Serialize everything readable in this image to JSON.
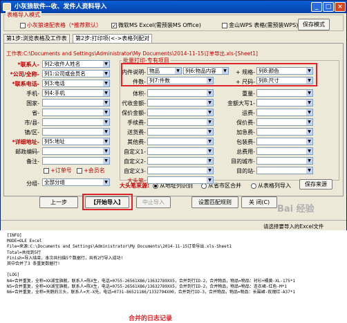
{
  "window": {
    "title": "小灰狼软件--收、发件人资料导入"
  },
  "top": {
    "group_label": "表格导入模式",
    "opt1": "小灰狼速配表格（*推荐默认）",
    "opt2": "微软MS Excel(需预装MS Office)",
    "opt3": "金山WPS 表格(需预装WPS)",
    "save_mode": "保存模式"
  },
  "tabs": [
    {
      "label": "第1步:浏览表格及工作表"
    },
    {
      "label": "第2步:打印项(<->表格列配对"
    }
  ],
  "worksheet": "工作表:C:\\Documents and Settings\\Administrator\\My Documents\\2014-11-15订单导出.xls-[Sheet1]",
  "left_fields": [
    {
      "label": "*联系人-",
      "value": "列2:收件人姓名"
    },
    {
      "label": "*公司/全称-",
      "value": "列1:公司或会员名"
    },
    {
      "label": "*联系电话-",
      "value": "列3:电话"
    },
    {
      "label": "手机-",
      "value": "列4:手机"
    },
    {
      "label": "国家-",
      "value": ""
    },
    {
      "label": "省-",
      "value": ""
    },
    {
      "label": "市/县-",
      "value": ""
    },
    {
      "label": "镇/区-",
      "value": ""
    },
    {
      "label": "*详细地址-",
      "value": "列5:地址"
    },
    {
      "label": "邮政编码-",
      "value": ""
    },
    {
      "label": "备注-",
      "value": ""
    }
  ],
  "remark_checks": {
    "a": "+订单号",
    "b": "+会员名"
  },
  "group": {
    "label": "分组-",
    "value": "全部分组"
  },
  "batch": {
    "label": "批量打印-专有项目",
    "name_label": "内件说明-",
    "name_a": "物品",
    "name_b": "列6:物品内容",
    "spec_label": "+ 规格-",
    "spec_value": "列8:颜色",
    "qty_label": "件数-",
    "qty_value": "列7:件数",
    "size_label": "+ 尺码-",
    "size_value": "列8:尺寸"
  },
  "mid_fields": [
    "体积-",
    "代收金额-",
    "保价金额-",
    "手续费-",
    "送货费-",
    "其他费-",
    "自定义1-",
    "自定义2-",
    "自定义3-",
    "大头笔-"
  ],
  "right_fields": [
    "重量-",
    "金额大写1-",
    "运费-",
    "保价费-",
    "加急费-",
    "包装费-",
    "总费用-",
    "目的城市-",
    "目的站-"
  ],
  "source": {
    "label": "大头笔来源:",
    "r1": "从地址列识别",
    "r2": "从省市区合并",
    "r3": "从表格列导入",
    "save": "保存来源"
  },
  "buttons": {
    "prev": "上一步",
    "start": "【开始导入】",
    "stop": "中止导入",
    "rules": "设置匹配规则",
    "close": "关 闭(C)"
  },
  "status": "请选择要导入的Excel文件",
  "watermark": "Bai 经验",
  "log": {
    "lines": [
      "[INFO]",
      "MODE=OLE Excel",
      "File=来源:C:\\Documents and Settings\\Administrator\\My Documents\\2014-11-15订单导出.xls-Sheet1",
      "Total=共找到5行",
      "Finish=导入结束，本次共扫描5个数据行，共有2行导入成功!",
      "其中合并了3 条重复数据行!",
      "",
      "[LOG]",
      "N4=合并重复，全称=XX湖宝旗舰，联系人=陈X生，电话=0755-26561X86/13632789XX5，合并到行ID-2，合并物品，物品=物品：衬衫+橘黄-XL-175*1",
      "N5=合并重复，全称=XX湖宝旗舰，联系人=陈X生，电话=0755-26561X86/13632789XX5，合并到行ID-2，合并物品，物品=物品：连衣裙-红色-M*1",
      "N6=合并重复，全称=天鹅的三头，联系人=大-X先，电话=0731-86521186/1332794X00，合并到行ID-3，合并物品，物品=物品：长围裙-玫瑰红-A37*1"
    ]
  },
  "caption": "合并的日志记录"
}
